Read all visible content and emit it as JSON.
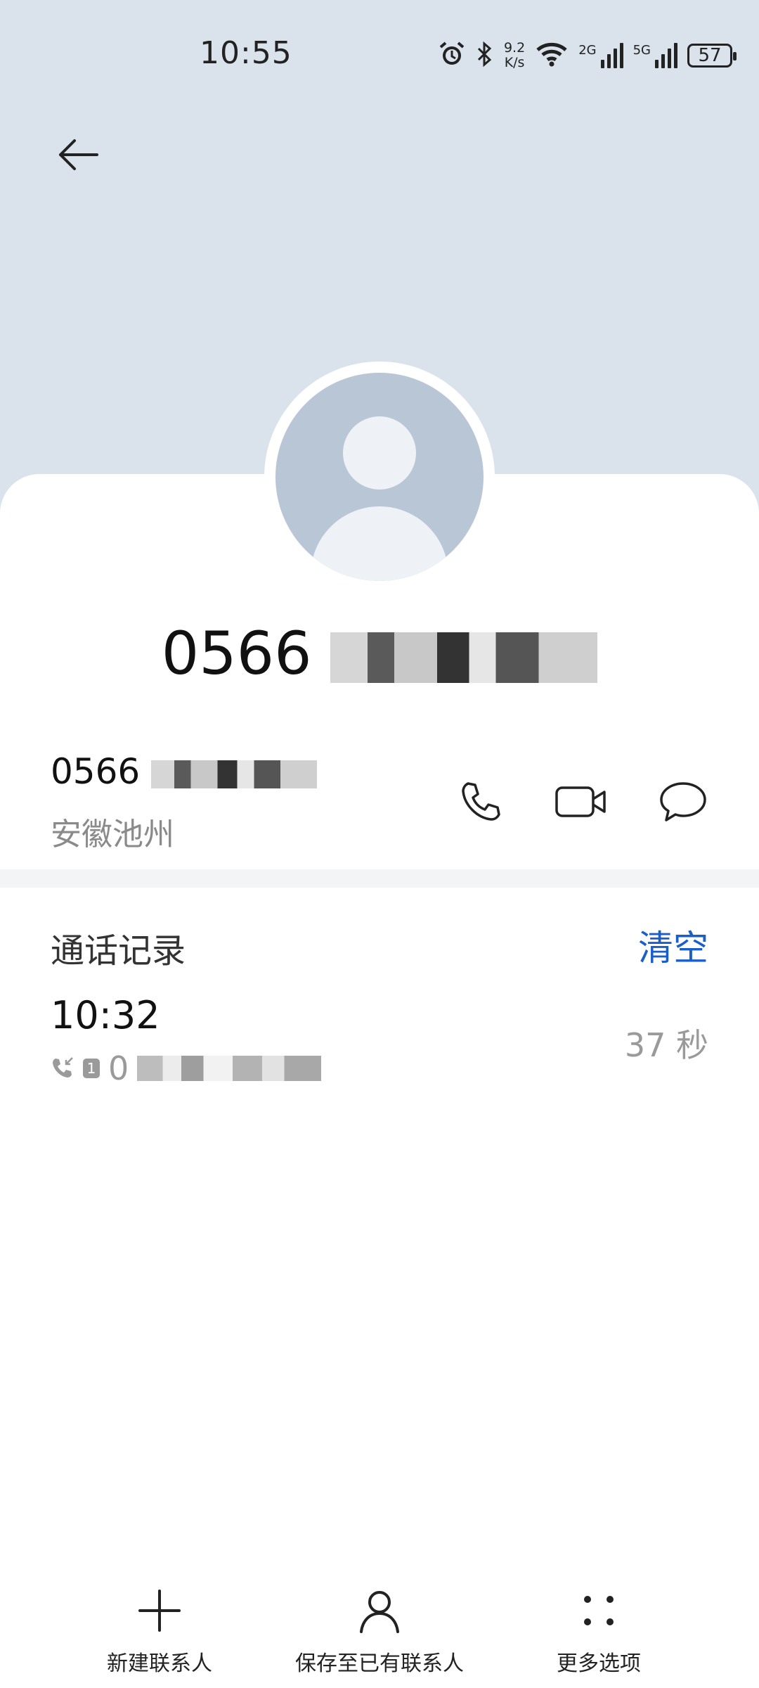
{
  "status_bar": {
    "time": "10:55",
    "net_speed_value": "9.2",
    "net_speed_unit": "K/s",
    "sim1_label": "2G",
    "sim2_label": "5G",
    "battery": "57",
    "icons": [
      "alarm-icon",
      "bluetooth-icon",
      "wifi-icon",
      "signal-icon",
      "battery-icon"
    ]
  },
  "header": {
    "back_icon": "back-arrow-icon",
    "title_prefix": "0566"
  },
  "number_row": {
    "number_prefix": "0566",
    "location": "安徽池州",
    "actions": [
      "phone-icon",
      "video-call-icon",
      "message-icon"
    ]
  },
  "call_log": {
    "title": "通话记录",
    "clear_label": "清空",
    "entries": [
      {
        "time": "10:32",
        "number_prefix": "0",
        "duration": "37 秒",
        "sim": "1"
      }
    ]
  },
  "bottom_bar": {
    "items": [
      {
        "label": "新建联系人",
        "icon": "plus-icon"
      },
      {
        "label": "保存至已有联系人",
        "icon": "person-icon"
      },
      {
        "label": "更多选项",
        "icon": "more-dots-icon"
      }
    ]
  },
  "colors": {
    "header_bg": "#dae3ec",
    "avatar_bg": "#b8c6d6",
    "accent": "#1a5fc7",
    "secondary_text": "#8a8a8a"
  }
}
